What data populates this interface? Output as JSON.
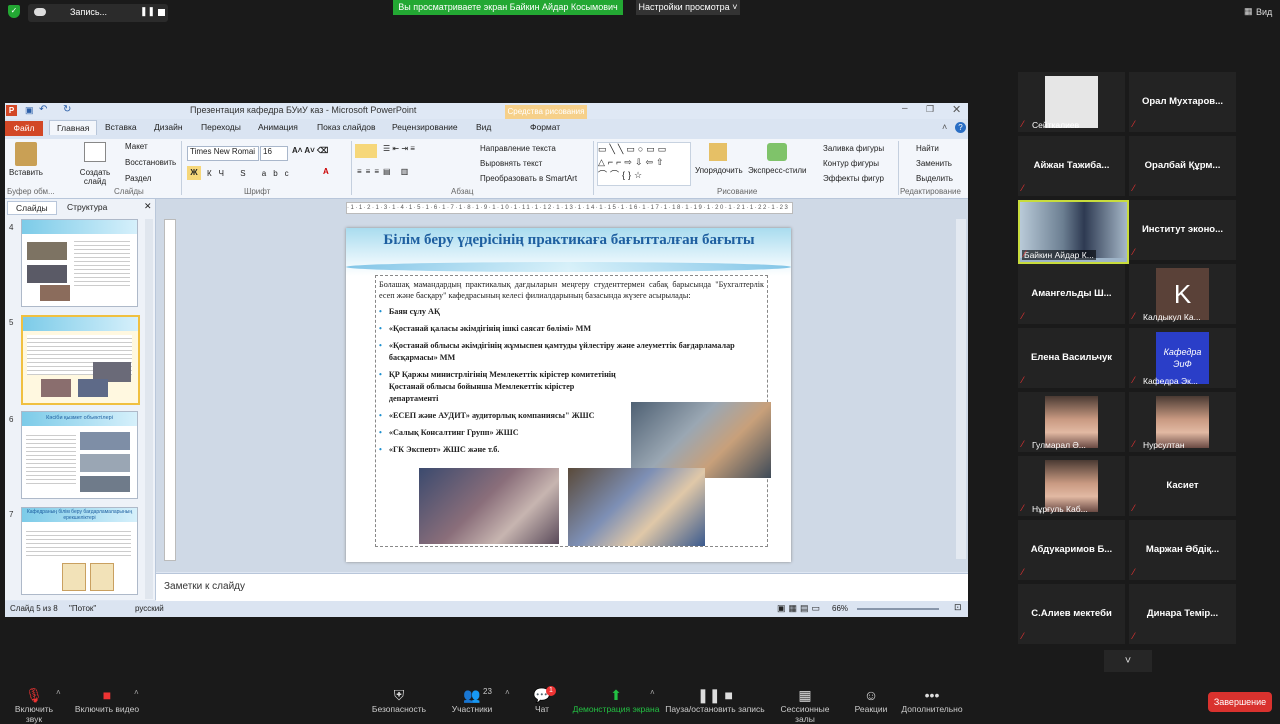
{
  "top_bar": {
    "record_label": "Запись...",
    "share_banner": "Вы просматриваете экран Байкин Айдар Косымович",
    "view_settings": "Настройки просмотра",
    "view_label": "Вид"
  },
  "ppt": {
    "title": "Презентация кафедра БУиУ каз  -  Microsoft PowerPoint",
    "context_tab_header": "Средства рисования",
    "tabs": [
      "Файл",
      "Главная",
      "Вставка",
      "Дизайн",
      "Переходы",
      "Анимация",
      "Показ слайдов",
      "Рецензирование",
      "Вид",
      "Формат"
    ],
    "ribbon": {
      "paste": "Вставить",
      "create_slide": "Создать слайд",
      "layout": "Макет",
      "reset": "Восстановить",
      "section": "Раздел",
      "font_name": "Times New Romai",
      "font_size": "16",
      "text_direction": "Направление текста",
      "align_text": "Выровнять текст",
      "smartart": "Преобразовать в SmartArt",
      "arrange": "Упорядочить",
      "express_styles": "Экспресс-стили",
      "shape_fill": "Заливка фигуры",
      "shape_outline": "Контур фигуры",
      "shape_effects": "Эффекты фигур",
      "find": "Найти",
      "replace": "Заменить",
      "select": "Выделить",
      "groups": [
        "Буфер обм...",
        "Слайды",
        "Шрифт",
        "Абзац",
        "Рисование",
        "Редактирование"
      ]
    },
    "pane_tabs": [
      "Слайды",
      "Структура"
    ],
    "thumb_numbers": [
      "4",
      "5",
      "6",
      "7"
    ],
    "thumb_titles": [
      "Кәсіби қызмет объектілері",
      "Кафедраның білім беру бағдарламаларының ерекшеліктері"
    ],
    "slide": {
      "title": "Білім беру үдерісінің практикаға бағытталған бағыты",
      "intro": "Болашақ мамандардың практикалық дағдыларын меңгеру студенттермен сабақ барысында \"Бухгалтерлік есеп және басқару\" кафедрасының келесі филиалдарының базасында жүзеге асырылады:",
      "bullets": [
        "Баян сұлу АҚ",
        "«Қостанай қаласы әкімдігінің ішкі саясат бөлімі» ММ",
        "«Қостанай облысы әкімдігінің жұмыспен қамтуды үйлестіру және әлеуметтік бағдарламалар басқармасы» ММ",
        "ҚР Қаржы министрлігінің Мемлекеттік кірістер комитетінің Қостанай облысы бойынша Мемлекеттік кірістер департаменті",
        "«ЕСЕП және АУДИТ» аудиторлық компаниясы\" ЖШС",
        "«Салық Консалтинг Групп» ЖШС",
        "«ГК Эксперт» ЖШС және т.б."
      ]
    },
    "notes_placeholder": "Заметки к слайду",
    "status": {
      "slide": "Слайд 5 из 8",
      "theme": "\"Поток\"",
      "lang": "русский",
      "zoom": "66%"
    }
  },
  "participants": [
    {
      "name": "Сейткалиев",
      "kind": "avatar"
    },
    {
      "name": "Орал  Мухтаров...",
      "kind": "text"
    },
    {
      "name": "Айжан  Тажиба...",
      "kind": "text"
    },
    {
      "name": "Оралбай  Құрм...",
      "kind": "text"
    },
    {
      "name": "Байкин Айдар К...",
      "kind": "video"
    },
    {
      "name": "Институт  эконо...",
      "kind": "text"
    },
    {
      "name": "Амангельды  Ш...",
      "kind": "text"
    },
    {
      "name": "Калдыкул Ка...",
      "kind": "letter",
      "letter": "K"
    },
    {
      "name": "Елена Васильчук",
      "kind": "text"
    },
    {
      "name": "Кафедра Эк...",
      "kind": "logo",
      "logo": "Кафедра ЭиФ"
    },
    {
      "name": "Гулмарал Ә...",
      "kind": "photo"
    },
    {
      "name": "Нурсултан",
      "kind": "photo"
    },
    {
      "name": "Нұрғуль Каб...",
      "kind": "photo"
    },
    {
      "name": "Касиет",
      "kind": "text"
    },
    {
      "name": "Абдукаримов  Б...",
      "kind": "text"
    },
    {
      "name": "Маржан  Әбдіқ...",
      "kind": "text"
    },
    {
      "name": "С.Алиев мектеби",
      "kind": "text"
    },
    {
      "name": "Динара  Темір...",
      "kind": "text"
    }
  ],
  "toolbar": {
    "mute": "Включить звук",
    "video": "Включить видео",
    "security": "Безопасность",
    "participants": "Участники",
    "participants_count": "23",
    "chat": "Чат",
    "chat_badge": "1",
    "share": "Демонстрация экрана",
    "pause_record": "Пауза/остановить запись",
    "breakout": "Сессионные залы",
    "reactions": "Реакции",
    "more": "Дополнительно",
    "end": "Завершение"
  },
  "colors": {
    "green": "#23a833",
    "end_red": "#d9322e",
    "ppt_blue": "#1e5fa0",
    "ppt_orange": "#d24726"
  }
}
